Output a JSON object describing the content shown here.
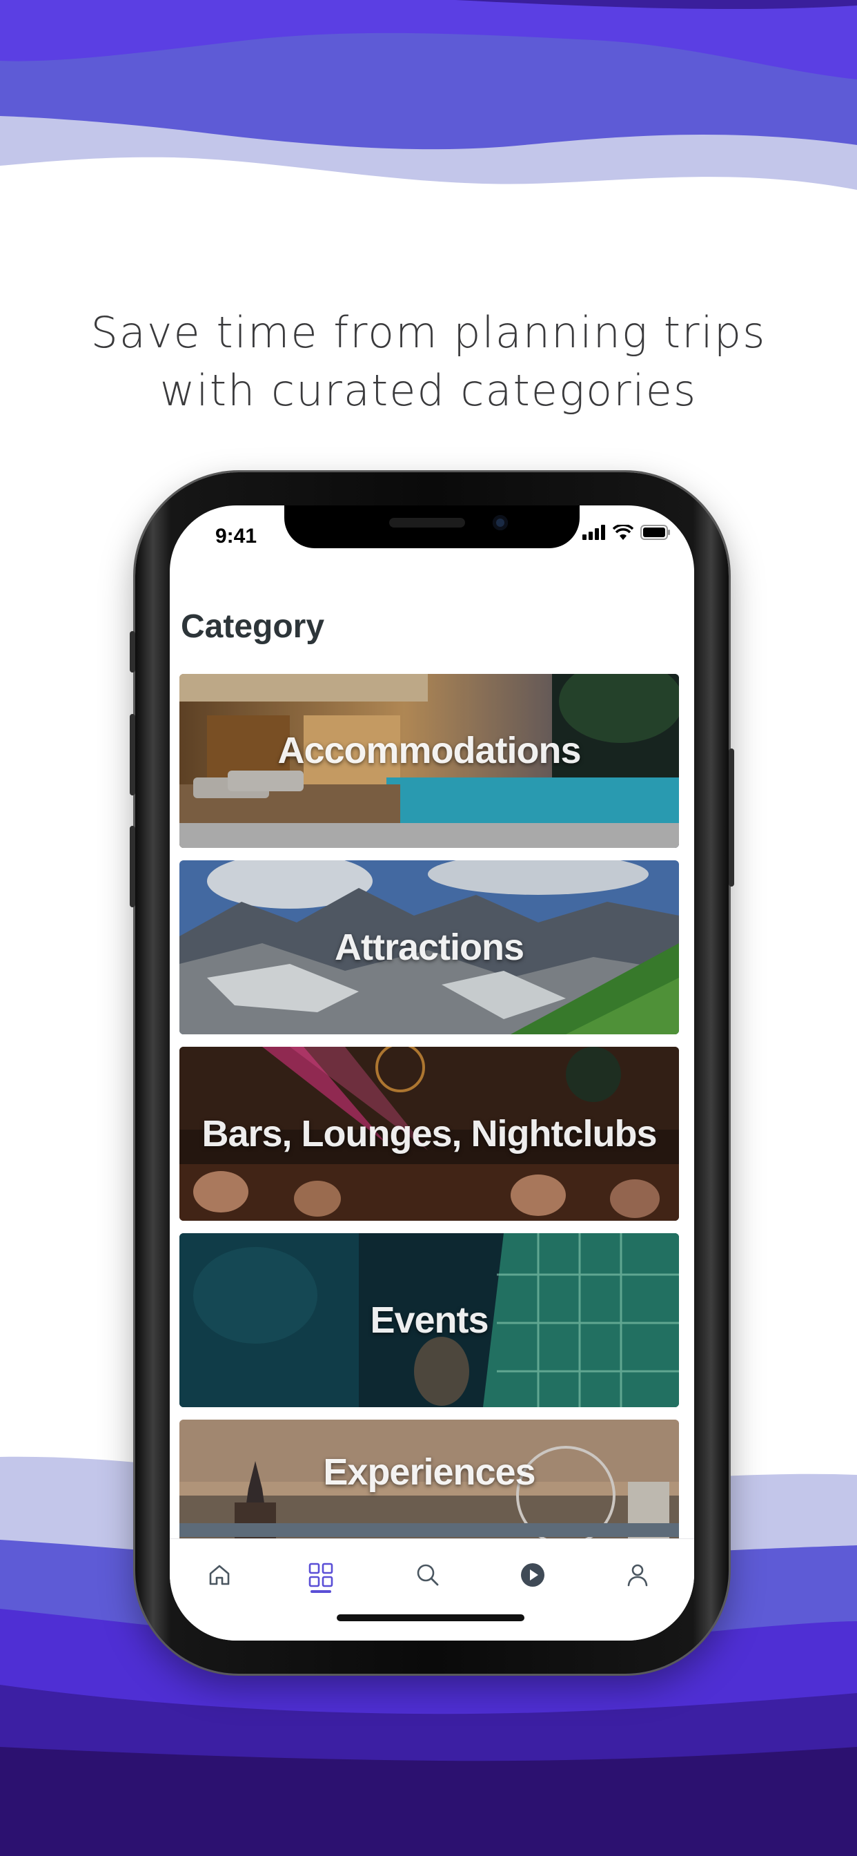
{
  "headline": {
    "line1": "Save time from planning trips",
    "line2": "with curated categories"
  },
  "status_bar": {
    "time": "9:41",
    "icons": [
      "signal-icon",
      "wifi-icon",
      "battery-icon"
    ]
  },
  "screen": {
    "title": "Category",
    "categories": [
      {
        "label": "Accommodations"
      },
      {
        "label": "Attractions"
      },
      {
        "label": "Bars, Lounges, Nightclubs"
      },
      {
        "label": "Events"
      },
      {
        "label": "Experiences"
      }
    ]
  },
  "tab_bar": {
    "items": [
      "home-icon",
      "category-grid-icon",
      "search-icon",
      "play-icon",
      "profile-icon"
    ],
    "active": "category-grid-icon"
  },
  "colors": {
    "accent": "#5a4fd6",
    "wave_dark": "#2c1170",
    "wave_mid": "#5e5bd6",
    "wave_light": "#c3c6ea"
  }
}
